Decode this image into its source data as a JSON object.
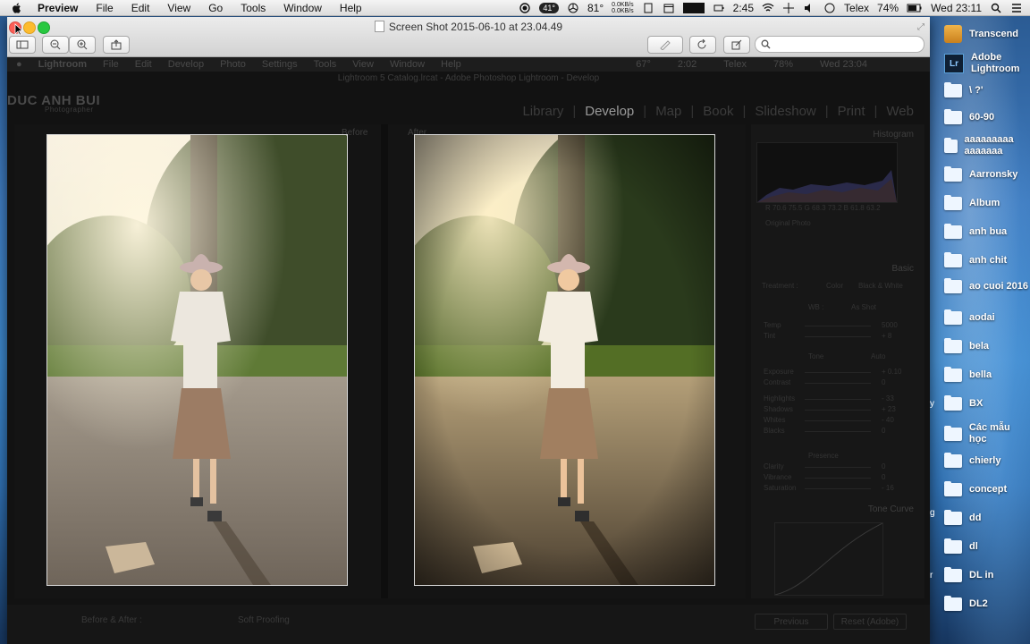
{
  "menubar": {
    "app": "Preview",
    "items": [
      "File",
      "Edit",
      "View",
      "Go",
      "Tools",
      "Window",
      "Help"
    ],
    "status": {
      "cpu_temp_badge": "41°",
      "temp": "81°",
      "net_up": "0.0KB/s",
      "net_down": "0.0KB/s",
      "battery_time": "2:45",
      "vpn": "Telex",
      "battery_pct": "74%",
      "clock": "Wed 23:11"
    }
  },
  "window": {
    "title": "Screen Shot 2015-06-10 at 23.04.49",
    "search_placeholder": "",
    "colors": {
      "close": "#fc5f57",
      "minimize": "#fdbc2e",
      "zoom": "#28c840"
    }
  },
  "lightroom": {
    "app_menu": "Lightroom",
    "menus": [
      "File",
      "Edit",
      "Develop",
      "Photo",
      "Settings",
      "Tools",
      "View",
      "Window",
      "Help"
    ],
    "status": {
      "temp": "67°",
      "battery": "2:02",
      "vpn": "Telex",
      "battery_pct": "78%",
      "clock": "Wed 23:04"
    },
    "title": "Lightroom 5 Catalog.lrcat - Adobe Photoshop Lightroom - Develop",
    "brand": "DUC ANH BUI",
    "brand_sub": "Photographer",
    "modules": [
      "Library",
      "Develop",
      "Map",
      "Book",
      "Slideshow",
      "Print",
      "Web"
    ],
    "active_module": "Develop",
    "before_label": "Before",
    "after_label": "After",
    "panel_histogram": "Histogram",
    "panel_basic": "Basic",
    "panel_tone_curve": "Tone Curve",
    "hist_readout": "R 70.6 75.5   G 68.3 73.2   B 61.8 63.2",
    "original_photo": "Original Photo",
    "treatment": "Treatment :",
    "treatment_color": "Color",
    "treatment_bw": "Black & White",
    "wb": "WB :",
    "wb_value": "As Shot",
    "tone": "Tone",
    "auto": "Auto",
    "presence": "Presence",
    "sliders": [
      {
        "name": "Temp",
        "value": "5000"
      },
      {
        "name": "Tint",
        "value": "+ 8"
      },
      {
        "name": "Exposure",
        "value": "+ 0.10"
      },
      {
        "name": "Contrast",
        "value": "0"
      },
      {
        "name": "Highlights",
        "value": "- 33"
      },
      {
        "name": "Shadows",
        "value": "+ 23"
      },
      {
        "name": "Whites",
        "value": "- 40"
      },
      {
        "name": "Blacks",
        "value": "0"
      },
      {
        "name": "Clarity",
        "value": "0"
      },
      {
        "name": "Vibrance",
        "value": "0"
      },
      {
        "name": "Saturation",
        "value": "- 16"
      }
    ],
    "bottom": {
      "before_after": "Before & After :",
      "soft_proofing": "Soft Proofing",
      "previous": "Previous",
      "reset": "Reset (Adobe)"
    }
  },
  "desktop": {
    "items": [
      {
        "label": "Transcend",
        "icon": "drive-icon"
      },
      {
        "label": "Adobe Lightroom",
        "icon": "lightroom-icon"
      },
      {
        "label": "\\ ?'",
        "icon": "folder-icon"
      },
      {
        "label": "60-90",
        "icon": "folder-icon"
      },
      {
        "label": "aaaaaaaaa aaaaaaa",
        "icon": "folder-icon"
      },
      {
        "label": "Aarronsky",
        "icon": "folder-icon"
      },
      {
        "label": "Album",
        "icon": "folder-icon"
      },
      {
        "label": "anh bua",
        "icon": "folder-icon"
      },
      {
        "label": "anh chit",
        "icon": "folder-icon"
      },
      {
        "label": "ao cuoi 2016",
        "icon": "folder-icon"
      },
      {
        "label": "aodai",
        "icon": "folder-icon"
      },
      {
        "label": "bela",
        "icon": "folder-icon"
      },
      {
        "label": "bella",
        "icon": "folder-icon"
      },
      {
        "label": "BX",
        "icon": "folder-icon"
      },
      {
        "label": "Các mẫu học",
        "icon": "folder-icon"
      },
      {
        "label": "chierly",
        "icon": "folder-icon"
      },
      {
        "label": "concept",
        "icon": "folder-icon"
      },
      {
        "label": "dd",
        "icon": "folder-icon"
      },
      {
        "label": "dl",
        "icon": "folder-icon"
      },
      {
        "label": "DL in",
        "icon": "folder-icon"
      },
      {
        "label": "DL2",
        "icon": "folder-icon"
      }
    ],
    "edge_text": [
      "y",
      "g",
      "r"
    ]
  }
}
